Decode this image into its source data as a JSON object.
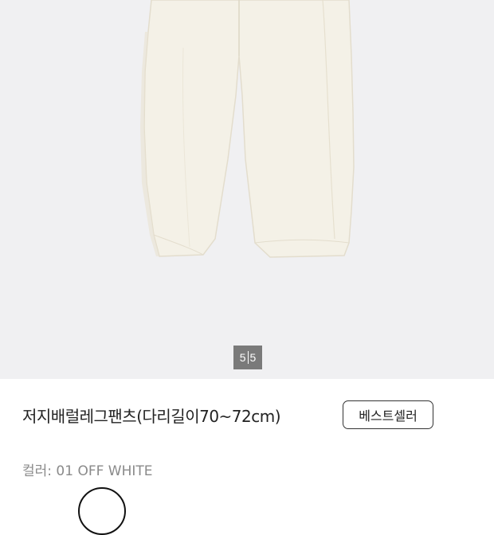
{
  "gallery": {
    "current_page": "5",
    "total_pages": "5",
    "image_icon": "product-photo-pants"
  },
  "product": {
    "title": "저지배럴레그팬츠(다리길이70~72cm)",
    "badge_label": "베스트셀러",
    "color_label": "컬러:",
    "color_value": "01 OFF WHITE"
  },
  "colors": {
    "gallery_bg": "#f0f0f2",
    "pants": "#f4f1e7",
    "counter_bg": "#7a7a7a",
    "text_primary": "#222222",
    "text_muted": "#8a8a8a"
  }
}
